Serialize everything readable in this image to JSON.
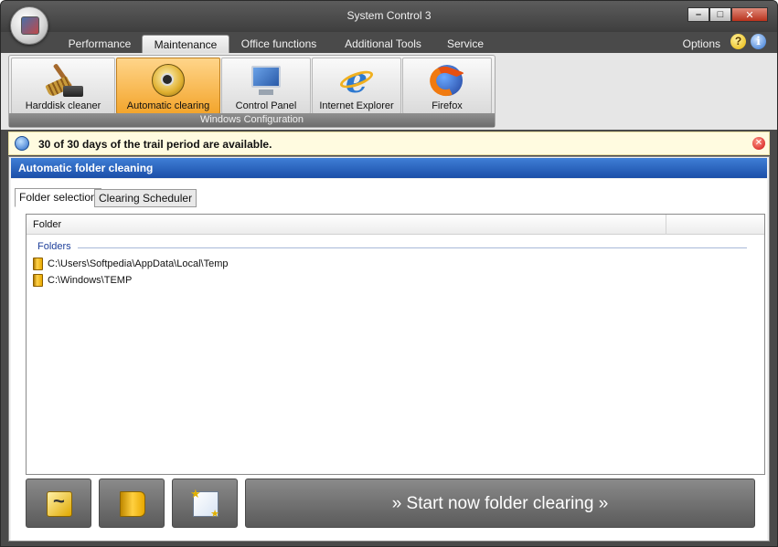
{
  "window": {
    "title": "System Control 3",
    "controls": {
      "minimize": "–",
      "maximize": "□",
      "close": "✕"
    }
  },
  "menu": {
    "tabs": [
      {
        "label": "Performance"
      },
      {
        "label": "Maintenance"
      },
      {
        "label": "Office functions"
      },
      {
        "label": "Additional Tools"
      },
      {
        "label": "Service"
      }
    ],
    "active_tab": "Maintenance",
    "options_label": "Options",
    "help_glyph": "?",
    "info_glyph": "i"
  },
  "ribbon": {
    "group_caption": "Windows Configuration",
    "buttons": [
      {
        "label": "Harddisk cleaner",
        "icon": "broom-icon"
      },
      {
        "label": "Automatic clearing",
        "icon": "safe-icon"
      },
      {
        "label": "Control Panel",
        "icon": "control-panel-icon"
      },
      {
        "label": "Internet Explorer",
        "icon": "internet-explorer-icon"
      },
      {
        "label": "Firefox",
        "icon": "firefox-icon"
      }
    ],
    "active_button": "Automatic clearing",
    "ie_glyph": "e"
  },
  "notice": {
    "text": "30 of 30 days of the trail period are available.",
    "close_glyph": "✕"
  },
  "panel": {
    "title": "Automatic folder cleaning",
    "tabs": [
      {
        "label": "Folder selection"
      },
      {
        "label": "Clearing Scheduler"
      }
    ],
    "active_tab": "Folder selection",
    "list": {
      "column": "Folder",
      "group": "Folders",
      "items": [
        "C:\\Users\\Softpedia\\AppData\\Local\\Temp",
        "C:\\Windows\\TEMP"
      ]
    },
    "actions": {
      "refresh": "refresh-icon",
      "add_folder": "folder-icon",
      "new_folder": "new-folder-icon",
      "start_label": "» Start now folder clearing »"
    }
  },
  "colors": {
    "title_bar": "#4a4a4a",
    "active_ribbon": "#f3a52c",
    "panel_header": "#1b4ea8",
    "notice_bg": "#fffbe0"
  }
}
